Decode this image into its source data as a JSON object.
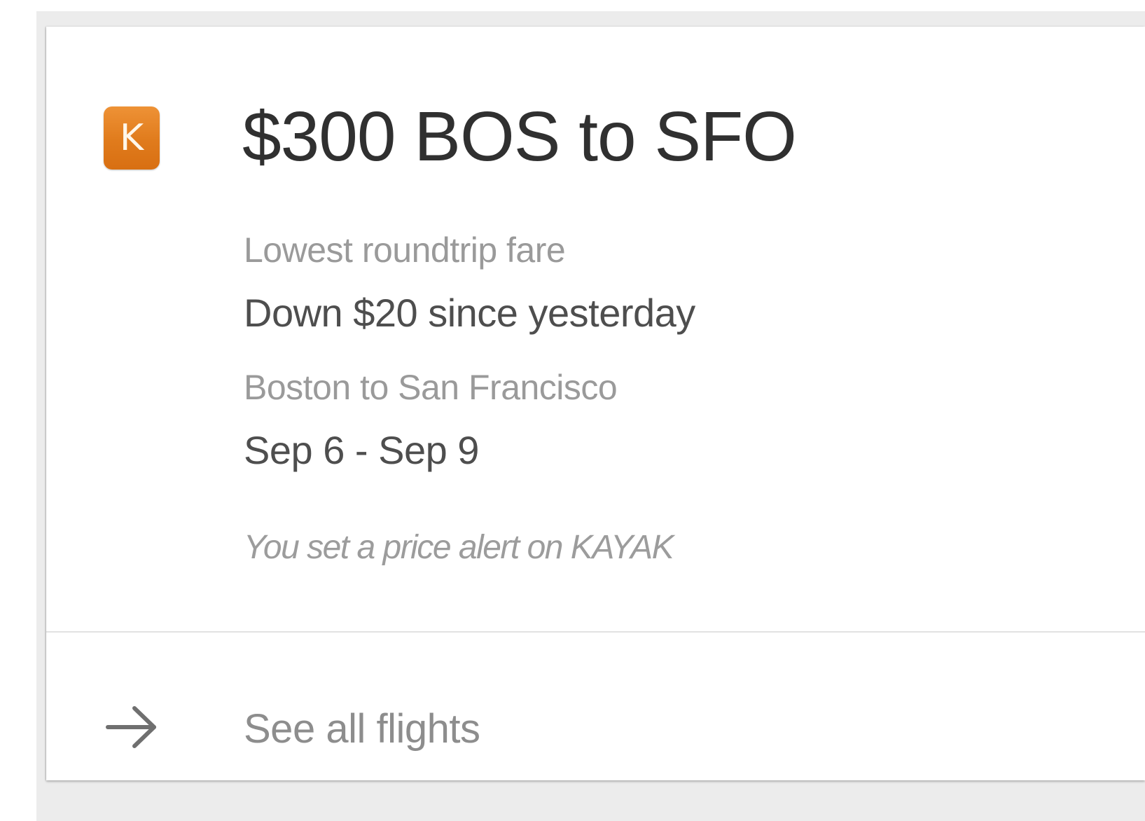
{
  "card": {
    "app_icon": {
      "name": "kayak-app-icon",
      "letter": "K",
      "color": "#e07b1c"
    },
    "title": "$300 BOS to SFO",
    "details": [
      {
        "label": "Lowest roundtrip fare",
        "value": "Down $20 since yesterday"
      },
      {
        "label": "Boston to San Francisco",
        "value": "Sep 6 - Sep 9"
      }
    ],
    "note": "You set a price alert on KAYAK",
    "footer": {
      "icon": "arrow-right-icon",
      "label": "See all flights"
    }
  }
}
